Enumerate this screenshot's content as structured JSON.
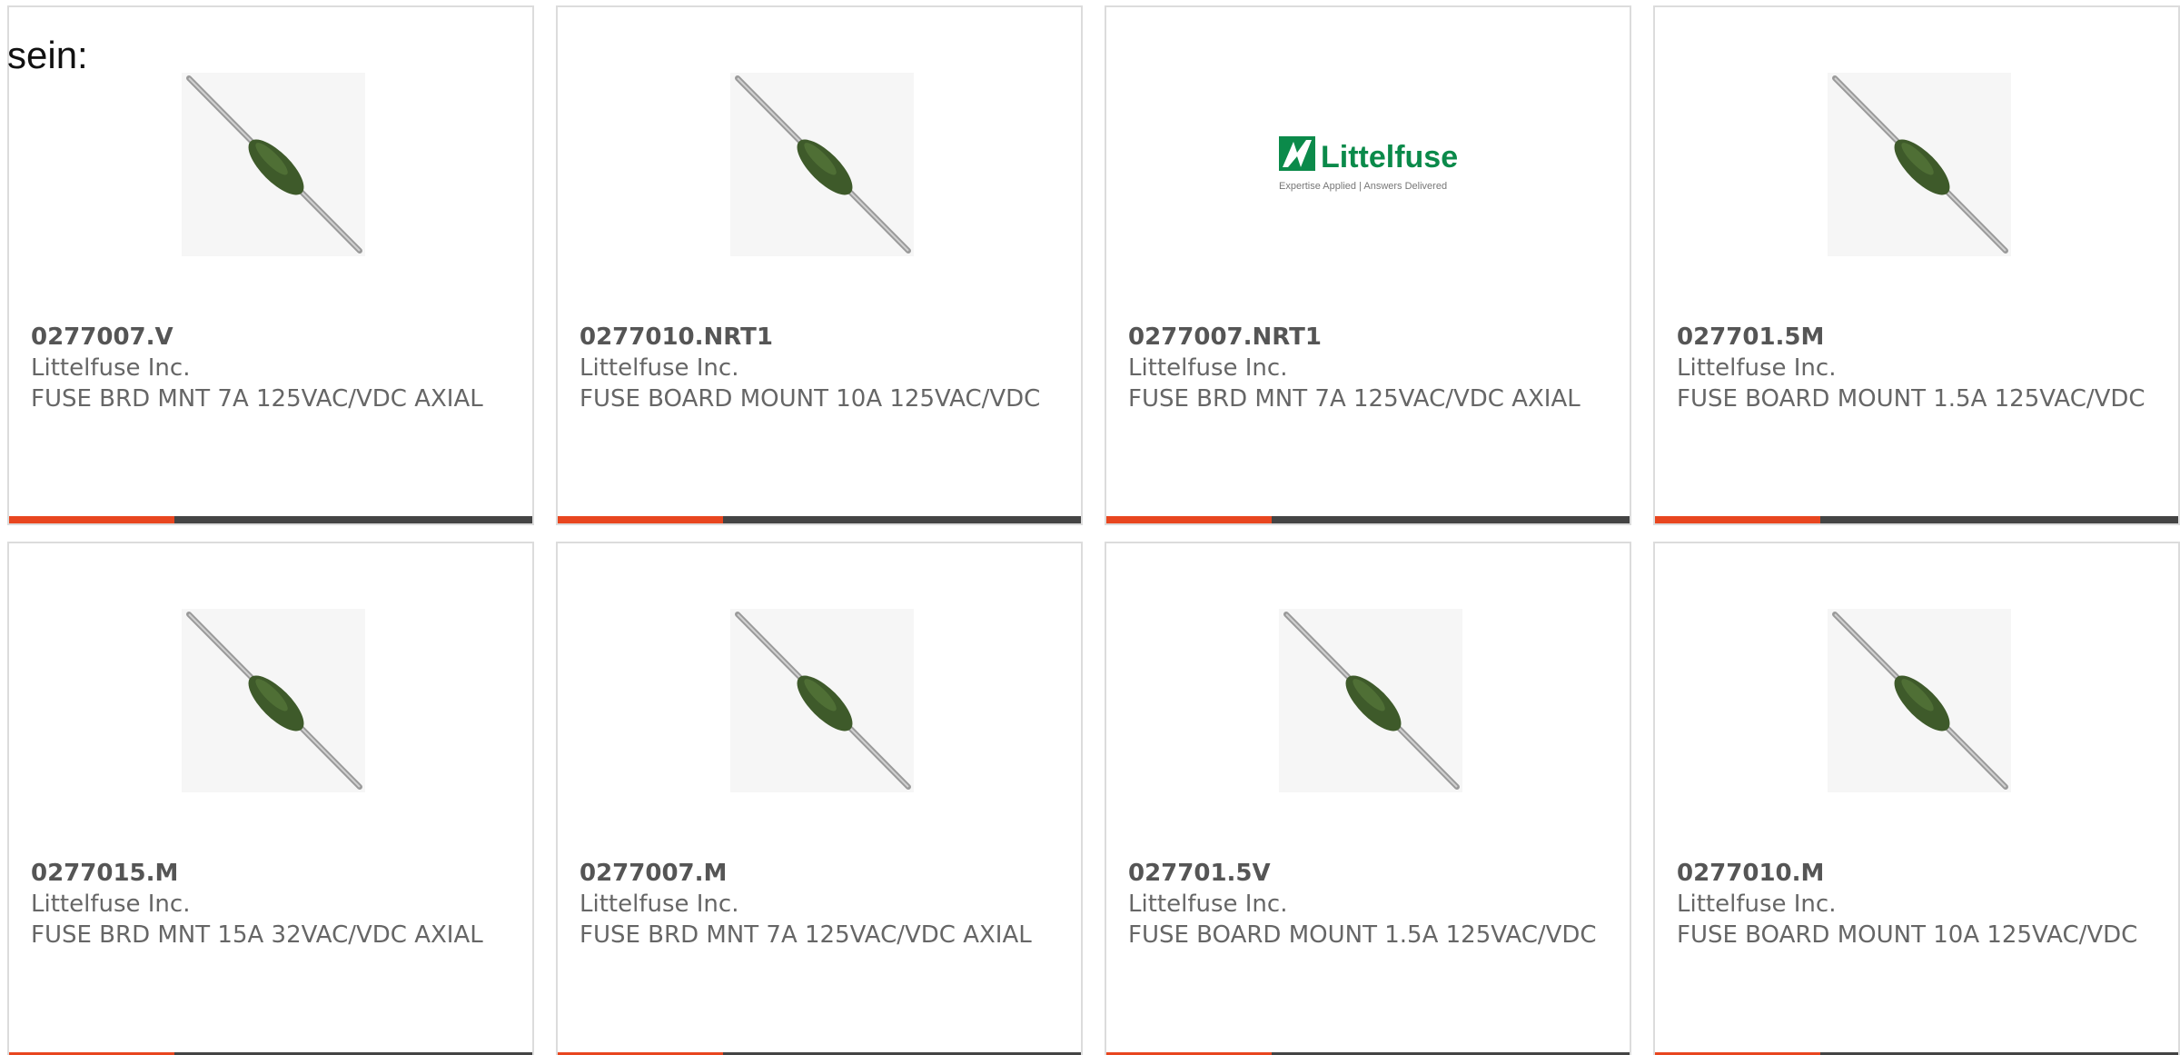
{
  "intro_text": "sein:",
  "accent_color": "#e8461f",
  "bar_color": "#444444",
  "products": [
    {
      "part_number": "0277007.V",
      "manufacturer": "Littelfuse Inc.",
      "description": "FUSE BRD MNT 7A 125VAC/VDC AXIAL",
      "image": "axial-fuse-icon"
    },
    {
      "part_number": "0277010.NRT1",
      "manufacturer": "Littelfuse Inc.",
      "description": "FUSE BOARD MOUNT 10A 125VAC/VDC",
      "image": "axial-fuse-icon"
    },
    {
      "part_number": "0277007.NRT1",
      "manufacturer": "Littelfuse Inc.",
      "description": "FUSE BRD MNT 7A 125VAC/VDC AXIAL",
      "image": "littelfuse-logo",
      "logo": {
        "name": "Littelfuse",
        "tagline": "Expertise Applied | Answers Delivered"
      }
    },
    {
      "part_number": "027701.5M",
      "manufacturer": "Littelfuse Inc.",
      "description": "FUSE BOARD MOUNT 1.5A 125VAC/VDC",
      "image": "axial-fuse-icon"
    },
    {
      "part_number": "0277015.M",
      "manufacturer": "Littelfuse Inc.",
      "description": "FUSE BRD MNT 15A 32VAC/VDC AXIAL",
      "image": "axial-fuse-icon"
    },
    {
      "part_number": "0277007.M",
      "manufacturer": "Littelfuse Inc.",
      "description": "FUSE BRD MNT 7A 125VAC/VDC AXIAL",
      "image": "axial-fuse-icon"
    },
    {
      "part_number": "027701.5V",
      "manufacturer": "Littelfuse Inc.",
      "description": "FUSE BOARD MOUNT 1.5A 125VAC/VDC",
      "image": "axial-fuse-icon"
    },
    {
      "part_number": "0277010.M",
      "manufacturer": "Littelfuse Inc.",
      "description": "FUSE BOARD MOUNT 10A 125VAC/VDC",
      "image": "axial-fuse-icon"
    }
  ]
}
